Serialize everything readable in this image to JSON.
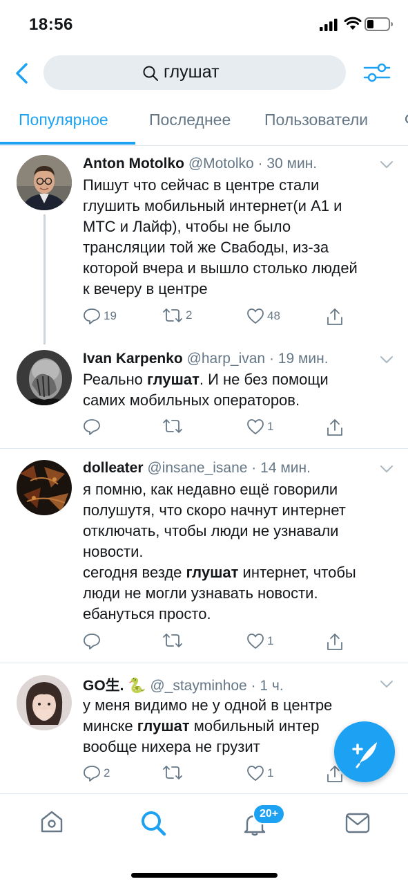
{
  "status_bar": {
    "time": "18:56"
  },
  "search": {
    "query": "глушат"
  },
  "tabs": [
    {
      "label": "Популярное",
      "active": true
    },
    {
      "label": "Последнее",
      "active": false
    },
    {
      "label": "Пользователи",
      "active": false
    }
  ],
  "tweets": [
    {
      "name": "Anton Motolko",
      "handle": "@Motolko",
      "time": "30 мин.",
      "body_lines": [
        "Пишут что сейчас в центре стали",
        "глушить мобильный интернет(и А1 и",
        "МТС и Лайф), чтобы не было",
        "трансляции той же Свабоды, из-за",
        "которой вчера и вышло столько людей",
        "к вечеру в центре"
      ],
      "replies": "19",
      "retweets": "2",
      "likes": "48"
    },
    {
      "name": "Ivan Karpenko",
      "handle": "@harp_ivan",
      "time": "19 мин.",
      "body": {
        "pre": "Реально ",
        "bold": "глушат",
        "post": ". И не без помощи",
        "line2": "самих мобильных операторов."
      },
      "replies": "",
      "retweets": "",
      "likes": "1"
    },
    {
      "name": "dolleater",
      "handle": "@insane_isane",
      "time": "14 мин.",
      "body_lines": [
        "я помню, как недавно ещё говорили",
        "полушутя, что скоро начнут интернет",
        "отключать, чтобы люди не узнавали",
        "новости."
      ],
      "body_rich": {
        "pre": "сегодня везде ",
        "bold": "глушат",
        "post": " интернет, чтобы"
      },
      "body_tail": [
        "люди не могли узнавать новости.",
        "ебануться просто."
      ],
      "replies": "",
      "retweets": "",
      "likes": "1"
    },
    {
      "name": "GO生. 🐍",
      "handle": "@_stayminhoe",
      "time": "1 ч.",
      "body_line1": "у меня видимо не у одной в центре",
      "body_rich": {
        "pre": "минске ",
        "bold": "глушат",
        "post": " мобильный интер"
      },
      "body_line3": "вообще нихера не грузит",
      "replies": "2",
      "retweets": "",
      "likes": "1"
    }
  ],
  "notifications_badge": "20+",
  "colors": {
    "accent": "#1da1f2",
    "secondary_text": "#657786",
    "divider": "#e1e8ed"
  },
  "icons": [
    "back-icon",
    "search-icon",
    "filter-icon",
    "reply-icon",
    "retweet-icon",
    "like-icon",
    "share-icon",
    "chevron-down-icon",
    "compose-icon",
    "home-icon",
    "notifications-icon",
    "messages-icon"
  ]
}
